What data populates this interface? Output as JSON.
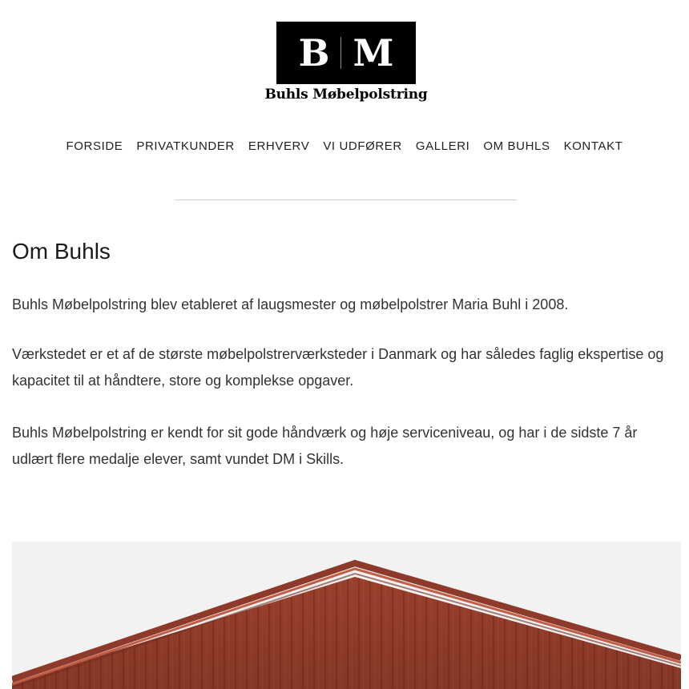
{
  "logo": {
    "letter_left": "B",
    "letter_right": "M",
    "name": "Buhls Møbelpolstring"
  },
  "nav": {
    "items": [
      {
        "label": "FORSIDE"
      },
      {
        "label": "PRIVATKUNDER"
      },
      {
        "label": "ERHVERV"
      },
      {
        "label": "VI UDFØRER"
      },
      {
        "label": "GALLERI"
      },
      {
        "label": "OM BUHLS"
      },
      {
        "label": "KONTAKT"
      }
    ]
  },
  "main": {
    "title": "Om Buhls",
    "paragraphs": [
      "Buhls Møbelpolstring blev etableret af laugsmester og møbelpolstrer Maria Buhl i 2008.",
      "Værkstedet er et af de største møbelpolstrerværksteder i Danmark og har således faglig ekspertise og kapacitet til at håndtere, store og komplekse opgaver.",
      "Buhls Møbelpolstring er kendt for sit gode håndværk og høje serviceniveau, og har i de sidste 7 år udlært flere medalje elever, samt vundet DM i Skills."
    ]
  },
  "hero": {
    "subject": "red wooden barn gable"
  },
  "colors": {
    "logo_bg": "#000000",
    "text": "#222222",
    "barn_red": "#a2432e",
    "sky": "#f2f2f2"
  }
}
